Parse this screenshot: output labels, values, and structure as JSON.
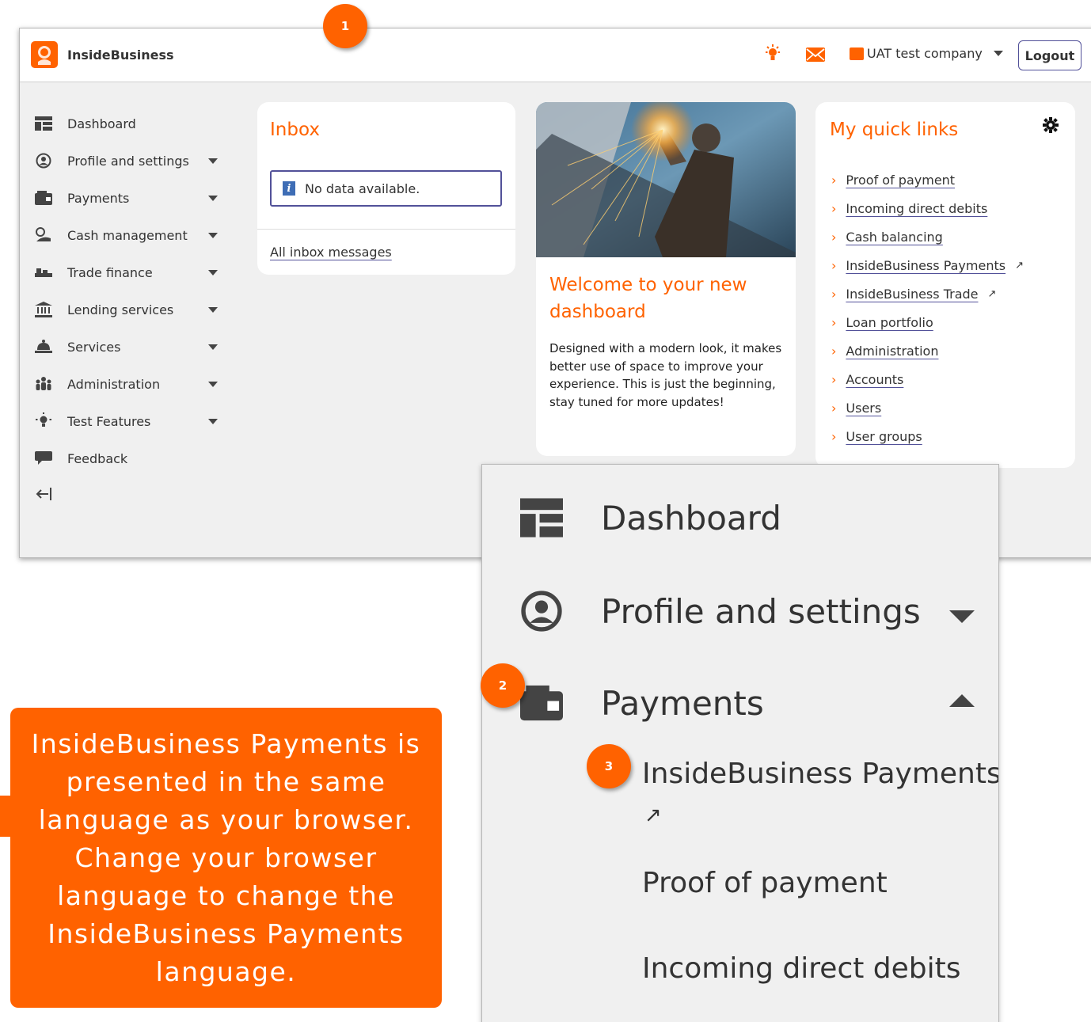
{
  "app": {
    "title": "InsideBusiness",
    "company": "UAT test company",
    "logout_label": "Logout"
  },
  "sidebar": {
    "items": [
      {
        "label": "Dashboard",
        "icon": "dashboard-icon",
        "expandable": false
      },
      {
        "label": "Profile and settings",
        "icon": "profile-icon",
        "expandable": true
      },
      {
        "label": "Payments",
        "icon": "wallet-icon",
        "expandable": true
      },
      {
        "label": "Cash management",
        "icon": "cash-management-icon",
        "expandable": true
      },
      {
        "label": "Trade finance",
        "icon": "trade-finance-icon",
        "expandable": true
      },
      {
        "label": "Lending services",
        "icon": "bank-icon",
        "expandable": true
      },
      {
        "label": "Services",
        "icon": "bell-icon",
        "expandable": true
      },
      {
        "label": "Administration",
        "icon": "people-icon",
        "expandable": true
      },
      {
        "label": "Test Features",
        "icon": "lightbulb-icon",
        "expandable": true
      },
      {
        "label": "Feedback",
        "icon": "speech-bubble-icon",
        "expandable": false
      }
    ]
  },
  "inbox": {
    "title": "Inbox",
    "empty_message": "No data available.",
    "all_messages_link": "All inbox messages"
  },
  "welcome": {
    "title": "Welcome to your new dashboard",
    "body": "Designed with a modern look, it makes better use of space to improve your experience. This is just the beginning, stay tuned for more updates!"
  },
  "quick_links": {
    "title": "My quick links",
    "items": [
      {
        "label": "Proof of payment",
        "external": false
      },
      {
        "label": "Incoming direct debits",
        "external": false
      },
      {
        "label": "Cash balancing",
        "external": false
      },
      {
        "label": "InsideBusiness Payments",
        "external": true
      },
      {
        "label": "InsideBusiness Trade",
        "external": true
      },
      {
        "label": "Loan portfolio",
        "external": false
      },
      {
        "label": "Administration",
        "external": false
      },
      {
        "label": "Accounts",
        "external": false
      },
      {
        "label": "Users",
        "external": false
      },
      {
        "label": "User groups",
        "external": false
      }
    ]
  },
  "zoom_menu": {
    "dashboard": "Dashboard",
    "profile": "Profile and settings",
    "payments": "Payments",
    "payments_items": [
      "InsideBusiness Payments",
      "Proof of payment",
      "Incoming direct debits"
    ]
  },
  "callouts": {
    "step1": "1",
    "step2": "2",
    "step3": "3",
    "note": "InsideBusiness Payments is presented in the same language as your browser. Change your browser language to change the InsideBusiness Payments language."
  },
  "colors": {
    "brand_orange": "#ff6200",
    "link_underline": "#525199",
    "background": "#f0f0f0"
  }
}
